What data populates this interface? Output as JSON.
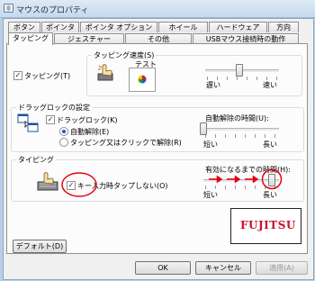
{
  "window": {
    "title": "マウスのプロパティ",
    "brand": "FUJITSU",
    "colors": {
      "accent": "#1e5aa8",
      "annotation": "#e3000f",
      "brand": "#c8102e"
    }
  },
  "tabs_row1": [
    {
      "label": "ボタン"
    },
    {
      "label": "ポインタ"
    },
    {
      "label": "ポインタ オプション"
    },
    {
      "label": "ホイール"
    },
    {
      "label": "ハードウェア"
    },
    {
      "label": "方向"
    }
  ],
  "tabs_row2": [
    {
      "label": "タッピング",
      "selected": true
    },
    {
      "label": "ジェスチャー"
    },
    {
      "label": "その他"
    },
    {
      "label": "USBマウス接続時の動作"
    }
  ],
  "tapping": {
    "enable_label": "タッピング(T)",
    "enabled": true,
    "speed_group": "タッピング速度(S)",
    "test_label": "テスト",
    "slow": "遅い",
    "fast": "速い",
    "speed_level": 0.67
  },
  "drag_lock": {
    "group_title": "ドラッグロックの設定",
    "enable_label": "ドラッグロック(K)",
    "enabled": true,
    "auto_release_label": "自動解除(E)",
    "tap_release_label": "タッピング又はクリックで解除(R)",
    "selected": "auto_release",
    "time_label": "自動解除の時間(U):",
    "short": "短い",
    "long": "長い",
    "time_level": 0.0
  },
  "typing": {
    "group_title": "タイピング",
    "disable_label": "キー入力時タップしない(O)",
    "checked": true,
    "time_label": "有効になるまでの時間(H):",
    "short": "短い",
    "long": "長い",
    "time_level": 1.0
  },
  "buttons": {
    "default": "デフォルト(D)",
    "ok": "OK",
    "cancel": "キャンセル",
    "apply": "適用(A)"
  },
  "icons": {
    "window": "mouse-icon",
    "tapping": "tapping-hand-icon",
    "test": "test-target-icon",
    "drag_lock": "drag-lock-windows-icon",
    "typing": "keyboard-hand-icon"
  }
}
